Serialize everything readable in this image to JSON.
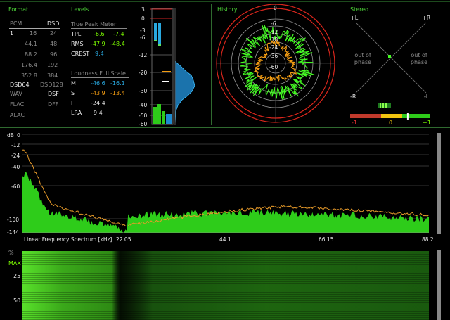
{
  "colors": {
    "section_title": "#4cd137",
    "spectrum_fill": "#2ecc1a",
    "spectrum_peak": "#e89b2a",
    "history_green": "#44ff22",
    "history_orange": "#f39c12",
    "history_red": "#d9261c",
    "meter_blue": "#29a9e0"
  },
  "format": {
    "title": "Format",
    "pcm": "PCM",
    "dsd": "DSD",
    "rows": [
      [
        "1",
        "16",
        "24"
      ],
      [
        "44.1",
        "48"
      ],
      [
        "88.2",
        "96"
      ],
      [
        "176.4",
        "192"
      ],
      [
        "352.8",
        "384"
      ]
    ],
    "dsd_rates": [
      "64",
      "128"
    ],
    "dsd64": "DSD64",
    "dsd128": "DSD128",
    "wav": "WAV",
    "dsf": "DSF",
    "flac": "FLAC",
    "dff": "DFF",
    "alac": "ALAC"
  },
  "levels": {
    "title": "Levels",
    "tpm_title": "True Peak Meter",
    "tpl_label": "TPL",
    "tpl_l": "-6.6",
    "tpl_r": "-7.4",
    "rms_label": "RMS",
    "rms_l": "-47.9",
    "rms_r": "-48.4",
    "crest_label": "CREST",
    "crest_value": "9.4",
    "lfs_title": "Loudness Full Scale",
    "m_label": "M",
    "m_a": "-46.6",
    "m_b": "-16.1",
    "s_label": "S",
    "s_a": "-43.9",
    "s_b": "-13.4",
    "i_label": "I",
    "i_value": "-24.4",
    "lra_label": "LRA",
    "lra_value": "9.4",
    "scale": [
      "3",
      "0",
      "-3",
      "-6",
      "-12",
      "-20",
      "-30",
      "-40",
      "-50",
      "-60"
    ]
  },
  "history": {
    "title": "History",
    "labels": [
      "0",
      "-6",
      "-12",
      "-18",
      "-24",
      "-36",
      "-60"
    ]
  },
  "stereo": {
    "title": "Stereo",
    "plus_l": "+L",
    "plus_r": "+R",
    "minus_r": "-R",
    "minus_l": "-L",
    "out_of_phase_left": "out of phase",
    "out_of_phase_right": "out of phase",
    "corr_min": "-1",
    "corr_mid": "0",
    "corr_max": "+1",
    "correlation": 0.42
  },
  "spectrum": {
    "unit": "dB",
    "y_ticks": [
      "0",
      "-12",
      "-24",
      "-40",
      "-60",
      "-100",
      "-144"
    ],
    "x_ticks": [
      "22.05",
      "44.1",
      "66.15",
      "88.2"
    ],
    "title": "Linear Frequency Spectrum [kHz]"
  },
  "spectrogram": {
    "unit": "%",
    "labels": [
      "MAX",
      "25",
      "50"
    ]
  }
}
